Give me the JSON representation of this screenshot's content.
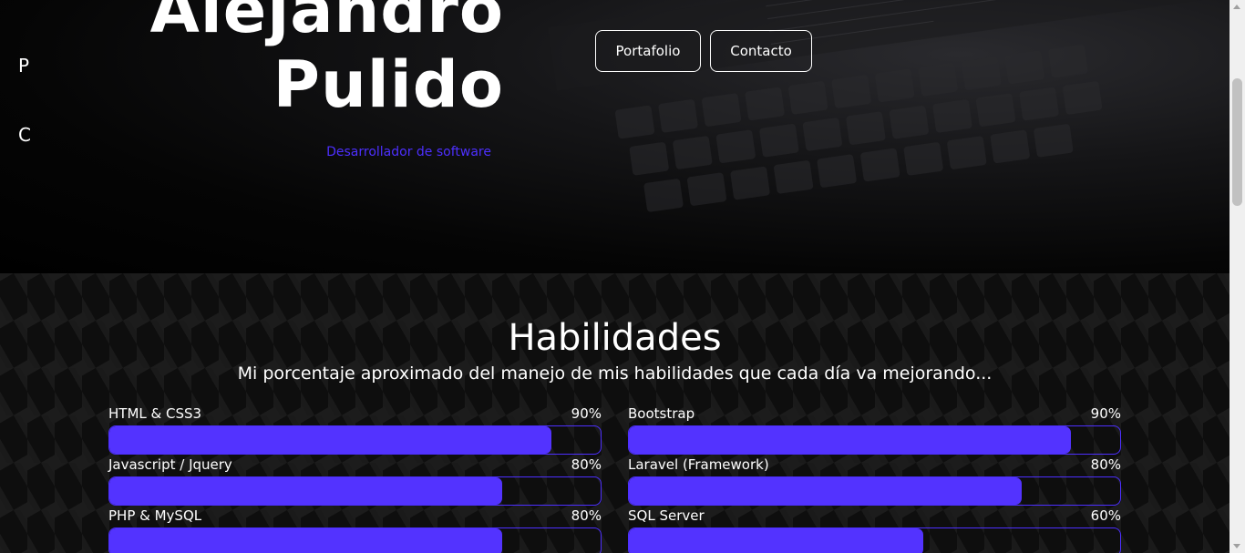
{
  "side_nav": [
    "P",
    "C"
  ],
  "hero": {
    "name_line1": "Alejandro",
    "name_line2": "Pulido",
    "subtitle": "Desarrollador de software"
  },
  "nav": {
    "portfolio_label": "Portafolio",
    "contact_label": "Contacto"
  },
  "skills": {
    "title": "Habilidades",
    "subtitle": "Mi porcentaje aproximado del manejo de mis habilidades que cada día va mejorando...",
    "items": [
      {
        "name": "HTML & CSS3",
        "percent_label": "90%",
        "percent": 90
      },
      {
        "name": "Bootstrap",
        "percent_label": "90%",
        "percent": 90
      },
      {
        "name": "Javascript / Jquery",
        "percent_label": "80%",
        "percent": 80
      },
      {
        "name": "Laravel (Framework)",
        "percent_label": "80%",
        "percent": 80
      },
      {
        "name": "PHP & MySQL",
        "percent_label": "80%",
        "percent": 80
      },
      {
        "name": "SQL Server",
        "percent_label": "60%",
        "percent": 60
      }
    ]
  },
  "colors": {
    "accent": "#5333ff",
    "subtitle": "#4d2fff",
    "background": "#000000"
  }
}
